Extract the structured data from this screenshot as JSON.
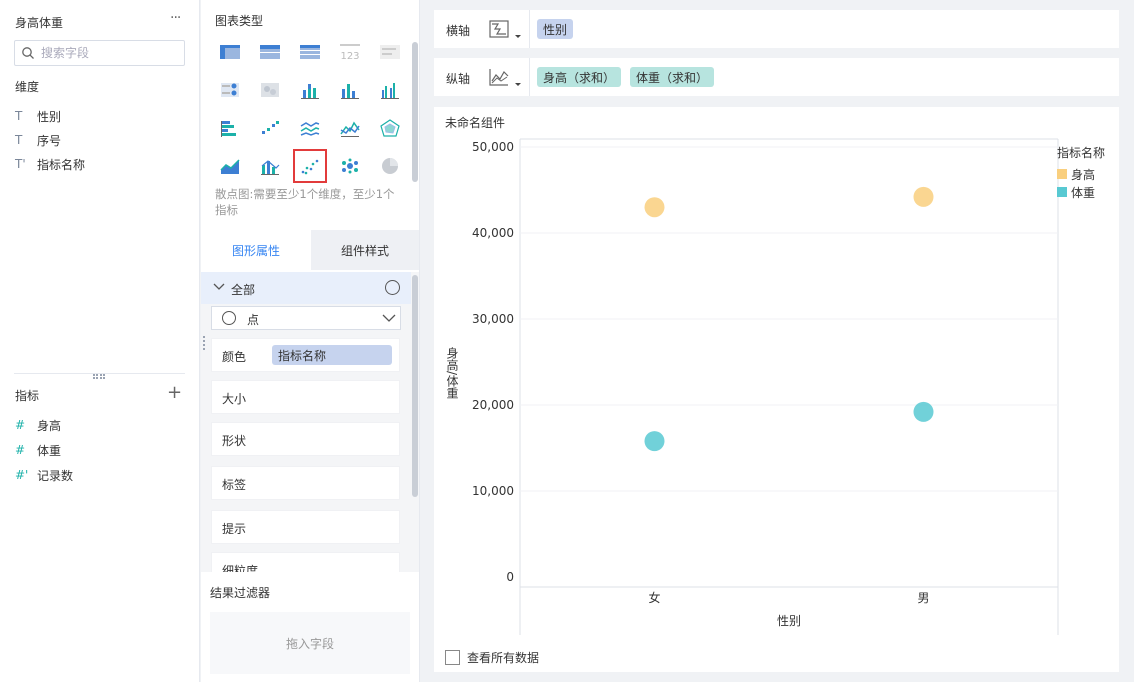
{
  "left": {
    "dataset_title": "身高体重",
    "more": "···",
    "search_placeholder": "搜索字段",
    "dimensions_title": "维度",
    "dimensions": [
      {
        "type": "T",
        "label": "性别"
      },
      {
        "type": "T",
        "label": "序号"
      },
      {
        "type": "T'",
        "label": "指标名称"
      }
    ],
    "measures_title": "指标",
    "add_label": "+",
    "measures": [
      {
        "type": "#",
        "label": "身高"
      },
      {
        "type": "#",
        "label": "体重"
      },
      {
        "type": "#'",
        "label": "记录数"
      }
    ]
  },
  "middle": {
    "chart_types_title": "图表类型",
    "chart_type_icons": [
      "grouped-table-icon",
      "detail-table-icon",
      "cross-table-icon",
      "kpi-number-icon",
      "text-card-icon",
      "map-dot-icon",
      "heatmap-icon",
      "stacked-bar-icon",
      "bar-chart-icon",
      "grouped-bar-icon",
      "horizontal-bar-icon",
      "scatter-trend-icon",
      "multi-line-icon",
      "line-chart-icon",
      "radar-icon",
      "area-chart-icon",
      "combo-chart-icon",
      "scatter-plot-icon",
      "bubble-cluster-icon",
      "pie-chart-icon"
    ],
    "selected_chart_type": "scatter-plot-icon",
    "chart_type_desc": "散点图:需要至少1个维度，至少1个指标",
    "tabs": {
      "props": "图形属性",
      "style": "组件样式"
    },
    "all_label": "全部",
    "mark_type": "点",
    "props": [
      {
        "label": "颜色",
        "value": "指标名称"
      },
      {
        "label": "大小"
      },
      {
        "label": "形状"
      },
      {
        "label": "标签"
      },
      {
        "label": "提示"
      },
      {
        "label": "细粒度"
      }
    ],
    "filter_title": "结果过滤器",
    "filter_drop": "拖入字段"
  },
  "right": {
    "x_axis_label": "横轴",
    "x_axis_fields": [
      "性别"
    ],
    "y_axis_label": "纵轴",
    "y_axis_fields": [
      "身高（求和）",
      "体重（求和）"
    ],
    "widget_title": "未命名组件",
    "view_all_label": "查看所有数据"
  },
  "chart_data": {
    "type": "scatter",
    "categories": [
      "女",
      "男"
    ],
    "xlabel": "性别",
    "ylabel": "身高/体重",
    "ylim": [
      0,
      50000
    ],
    "yticks": [
      0,
      10000,
      20000,
      30000,
      40000,
      50000
    ],
    "ytick_labels": [
      "0",
      "10,000",
      "20,000",
      "30,000",
      "40,000",
      "50,000"
    ],
    "legend_title": "指标名称",
    "legend_position": "top-right",
    "series": [
      {
        "name": "身高",
        "color": "#f9cf7e",
        "values": [
          43000,
          44200
        ]
      },
      {
        "name": "体重",
        "color": "#58c9d2",
        "values": [
          15800,
          19200
        ]
      }
    ]
  }
}
